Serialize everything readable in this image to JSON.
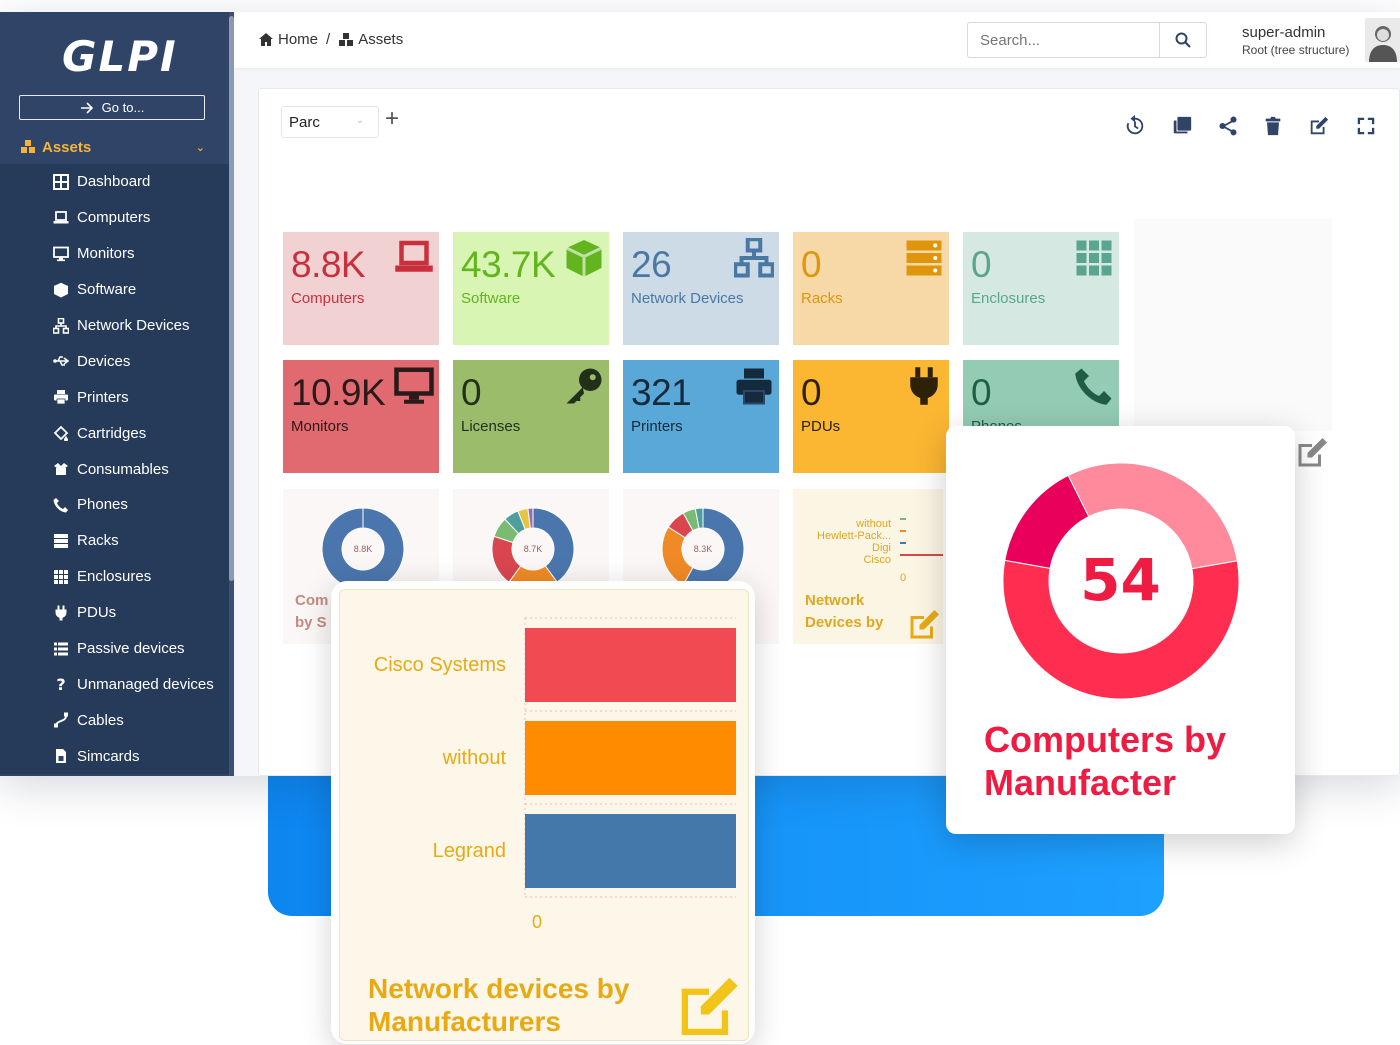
{
  "app": {
    "logo": "GLPI",
    "goto_label": "Go to...",
    "section": "Assets",
    "menu": [
      {
        "label": "Dashboard",
        "icon": "dashboard-icon"
      },
      {
        "label": "Computers",
        "icon": "laptop-icon"
      },
      {
        "label": "Monitors",
        "icon": "monitor-icon"
      },
      {
        "label": "Software",
        "icon": "cube-icon"
      },
      {
        "label": "Network Devices",
        "icon": "network-icon"
      },
      {
        "label": "Devices",
        "icon": "usb-icon"
      },
      {
        "label": "Printers",
        "icon": "printer-icon"
      },
      {
        "label": "Cartridges",
        "icon": "fill-drip-icon"
      },
      {
        "label": "Consumables",
        "icon": "box-open-icon"
      },
      {
        "label": "Phones",
        "icon": "phone-icon"
      },
      {
        "label": "Racks",
        "icon": "server-icon"
      },
      {
        "label": "Enclosures",
        "icon": "grid-icon"
      },
      {
        "label": "PDUs",
        "icon": "plug-icon"
      },
      {
        "label": "Passive devices",
        "icon": "list-icon"
      },
      {
        "label": "Unmanaged devices",
        "icon": "question-icon"
      },
      {
        "label": "Cables",
        "icon": "cable-icon"
      },
      {
        "label": "Simcards",
        "icon": "simcard-icon"
      }
    ]
  },
  "topbar": {
    "breadcrumb": [
      "Home",
      "Assets"
    ],
    "search_placeholder": "Search...",
    "user_name": "super-admin",
    "user_entity": "Root (tree structure)"
  },
  "dashboard": {
    "selected": "Parc",
    "add_label": "+",
    "tiles": [
      {
        "value": "8.8K",
        "label": "Computers",
        "icon": "laptop-icon",
        "bg": "#f2d1d3",
        "fg": "#c9303d"
      },
      {
        "value": "43.7K",
        "label": "Software",
        "icon": "cube-icon",
        "bg": "#d9f5b4",
        "fg": "#63b51f"
      },
      {
        "value": "26",
        "label": "Network Devices",
        "icon": "network-icon",
        "bg": "#ccdbe6",
        "fg": "#4a78a5"
      },
      {
        "value": "0",
        "label": "Racks",
        "icon": "server-icon",
        "bg": "#f7d9a8",
        "fg": "#e0960c"
      },
      {
        "value": "0",
        "label": "Enclosures",
        "icon": "grid-icon",
        "bg": "#d5e9e2",
        "fg": "#5aa58f"
      },
      {
        "value": "10.9K",
        "label": "Monitors",
        "icon": "monitor-icon",
        "bg": "#e06a70",
        "fg": "#2a1a1a"
      },
      {
        "value": "0",
        "label": "Licenses",
        "icon": "key-icon",
        "bg": "#9bbd6b",
        "fg": "#22301a"
      },
      {
        "value": "321",
        "label": "Printers",
        "icon": "printer-icon",
        "bg": "#5aa8d8",
        "fg": "#142a3d"
      },
      {
        "value": "0",
        "label": "PDUs",
        "icon": "plug-icon",
        "bg": "#fbb632",
        "fg": "#2d2208"
      },
      {
        "value": "0",
        "label": "Phones",
        "icon": "phone-icon",
        "bg": "#93cbb4",
        "fg": "#1f5d46"
      }
    ],
    "mini_donuts": [
      "8.8K",
      "8.7K",
      "8.3K"
    ],
    "mini_labels": [
      "Com",
      "by S",
      "Network",
      "Devices by"
    ],
    "mini_bar_categories": [
      "without",
      "Hewlett-Pack...",
      "Digi",
      "Cisco"
    ],
    "mini_bar_zero": "0"
  },
  "overlay_bar": {
    "title_line1": "Network devices by",
    "title_line2": "Manufacturers",
    "zero_label": "0"
  },
  "overlay_donut": {
    "total": "54",
    "title_line1": "Computers by",
    "title_line2": "Manufacter"
  },
  "chart_data": [
    {
      "type": "bar",
      "orientation": "horizontal",
      "title": "Network devices by Manufacturers",
      "categories": [
        "Cisco Systems",
        "without",
        "Legrand"
      ],
      "colors": [
        "#f24a53",
        "#ff8c00",
        "#4478aa"
      ],
      "values": [
        1,
        1,
        1
      ],
      "xlim": [
        0,
        1
      ],
      "xlabel": "",
      "ylabel": "",
      "grid": true
    },
    {
      "type": "pie",
      "donut": true,
      "title": "Computers by Manufacter",
      "total": 54,
      "slices": [
        {
          "value": 30,
          "color": "#ff2d50"
        },
        {
          "value": 8,
          "color": "#e8005a"
        },
        {
          "value": 16,
          "color": "#ff8a9b"
        }
      ]
    }
  ]
}
